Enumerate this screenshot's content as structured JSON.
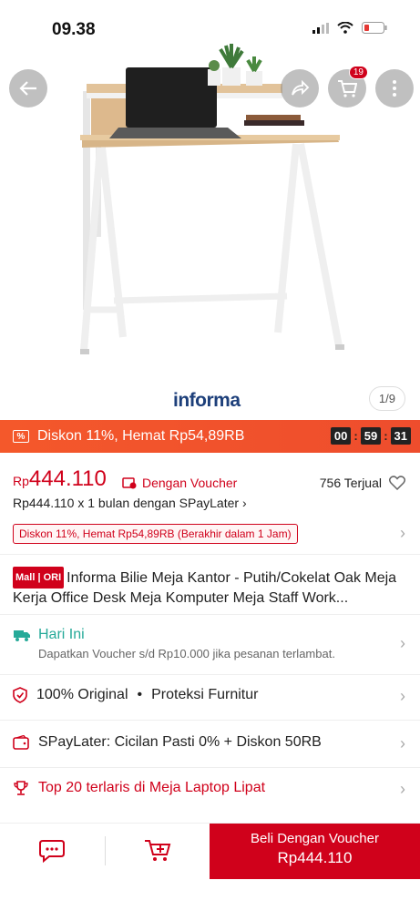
{
  "status": {
    "time": "09.38"
  },
  "nav": {
    "cart_count": "19"
  },
  "gallery": {
    "brand": "informa",
    "counter": "1/9"
  },
  "flash": {
    "text": "Diskon 11%, Hemat Rp54,89RB",
    "h": "00",
    "m": "59",
    "s": "31",
    "icon": "%"
  },
  "price": {
    "currency": "Rp",
    "value": "444.110",
    "voucher_label": "Dengan Voucher",
    "sold": "756 Terjual",
    "spaylater": "Rp444.110 x 1 bulan dengan SPayLater",
    "discount_note": "Diskon 11%, Hemat Rp54,89RB (Berakhir dalam 1 Jam)"
  },
  "product": {
    "mall_badge": "Mall | ORI",
    "title": "Informa Bilie Meja Kantor - Putih/Cokelat Oak Meja Kerja Office Desk Meja Komputer Meja Staff Work..."
  },
  "delivery": {
    "title": "Hari Ini",
    "subtitle": "Dapatkan Voucher s/d Rp10.000 jika pesanan terlambat."
  },
  "guarantee": {
    "original": "100% Original",
    "dot": "•",
    "protection": "Proteksi Furnitur"
  },
  "spaylater_row": {
    "label": "SPayLater: Cicilan Pasti 0% + Diskon 50RB"
  },
  "ranking": {
    "label": "Top 20 terlaris di Meja Laptop Lipat"
  },
  "bottom": {
    "buy_label": "Beli Dengan Voucher",
    "buy_price": "Rp444.110"
  },
  "colors": {
    "brand_red": "#d0011b",
    "flash_orange": "#f4582b",
    "teal": "#26aa99"
  }
}
